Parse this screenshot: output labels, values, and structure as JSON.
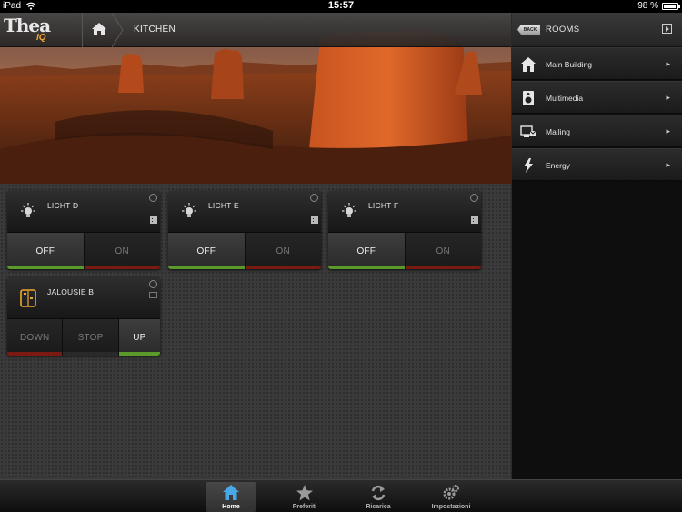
{
  "status_bar": {
    "carrier": "iPad",
    "time": "15:57",
    "battery": "98 %",
    "battery_level": 0.98
  },
  "app": {
    "logo_main": "Thea",
    "logo_sub": "IQ"
  },
  "breadcrumb": {
    "title": "KITCHEN"
  },
  "tiles": [
    {
      "label": "LICHT D",
      "icon": "lightbulb-icon",
      "buttons": [
        "OFF",
        "ON"
      ],
      "active": "OFF"
    },
    {
      "label": "LICHT E",
      "icon": "lightbulb-icon",
      "buttons": [
        "OFF",
        "ON"
      ],
      "active": "OFF"
    },
    {
      "label": "LICHT F",
      "icon": "lightbulb-icon",
      "buttons": [
        "OFF",
        "ON"
      ],
      "active": "OFF"
    },
    {
      "label": "JALOUSIE B",
      "icon": "blind-icon",
      "buttons": [
        "DOWN",
        "STOP",
        "UP"
      ],
      "active": "UP"
    }
  ],
  "side_panel": {
    "back_label": "BACK",
    "title": "ROOMS",
    "rooms": [
      {
        "label": "Main Building",
        "icon": "building-icon"
      },
      {
        "label": "Multimedia",
        "icon": "speaker-icon"
      },
      {
        "label": "Mailing",
        "icon": "mailing-icon"
      },
      {
        "label": "Energy",
        "icon": "lightning-icon"
      }
    ]
  },
  "tabs": [
    {
      "label": "Home",
      "icon": "home-icon",
      "active": true
    },
    {
      "label": "Preferiti",
      "icon": "star-icon",
      "active": false
    },
    {
      "label": "Ricarica",
      "icon": "refresh-icon",
      "active": false
    },
    {
      "label": "Impostazioni",
      "icon": "gears-icon",
      "active": false
    }
  ],
  "colors": {
    "bar_green": "#5a9a2a",
    "bar_red": "#8a1a12",
    "accent_orange": "#f0a830"
  }
}
